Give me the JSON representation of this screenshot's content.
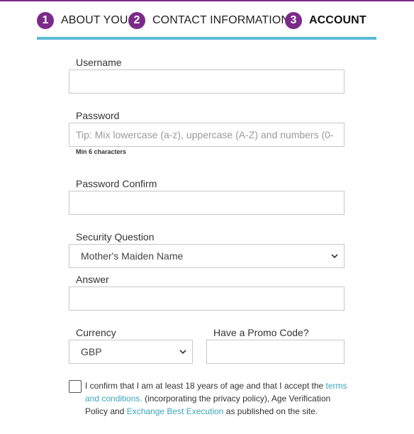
{
  "steps": [
    {
      "number": "1",
      "label": "ABOUT YOU"
    },
    {
      "number": "2",
      "label": "CONTACT INFORMATION"
    },
    {
      "number": "3",
      "label": "ACCOUNT"
    }
  ],
  "form": {
    "username": {
      "label": "Username",
      "value": "",
      "placeholder": ""
    },
    "password": {
      "label": "Password",
      "value": "",
      "placeholder": "Tip: Mix lowercase (a-z), uppercase (A-Z) and numbers (0-",
      "hint": "Min 6 characters"
    },
    "password_confirm": {
      "label": "Password Confirm",
      "value": "",
      "placeholder": ""
    },
    "security_question": {
      "label": "Security Question",
      "selected": "Mother's Maiden Name"
    },
    "answer": {
      "label": "Answer",
      "value": "",
      "placeholder": ""
    },
    "currency": {
      "label": "Currency",
      "selected": "GBP"
    },
    "promo": {
      "label": "Have a Promo Code?",
      "value": "",
      "placeholder": ""
    }
  },
  "consent": {
    "text_1": "I confirm that I am at least 18 years of age and that I accept the ",
    "link_terms": "terms and conditions.",
    "text_2": " (incorporating the privacy policy), Age Verification Policy and ",
    "link_execution": "Exchange Best Execution",
    "text_3": " as published on the site."
  },
  "colors": {
    "accent": "#7b2a8a",
    "progress": "#5bbad5",
    "link": "#3aa6b9"
  },
  "icons": {
    "select_arrow": "chevron-down-icon"
  }
}
